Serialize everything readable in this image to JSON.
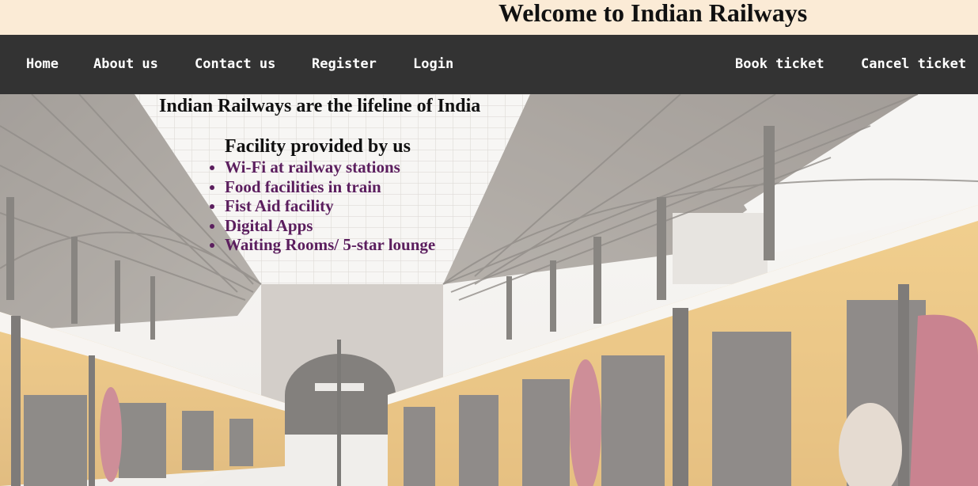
{
  "header": {
    "title": "Welcome to Indian Railways"
  },
  "nav": {
    "home": "Home",
    "about": "About us",
    "contact": "Contact us",
    "register": "Register",
    "login": "Login",
    "book": "Book ticket",
    "cancel": "Cancel ticket"
  },
  "main": {
    "tagline": "Indian Railways are the lifeline of India",
    "facilities_title": "Facility provided by us",
    "facilities": [
      "Wi-Fi at railway stations",
      "Food facilities in train",
      "Fist Aid facility",
      "Digital Apps",
      "Waiting Rooms/ 5-star lounge"
    ]
  },
  "colors": {
    "header_bg": "#fbebd6",
    "nav_bg": "#333333",
    "nav_text": "#ffffff",
    "list_text": "#5b1e5e"
  }
}
